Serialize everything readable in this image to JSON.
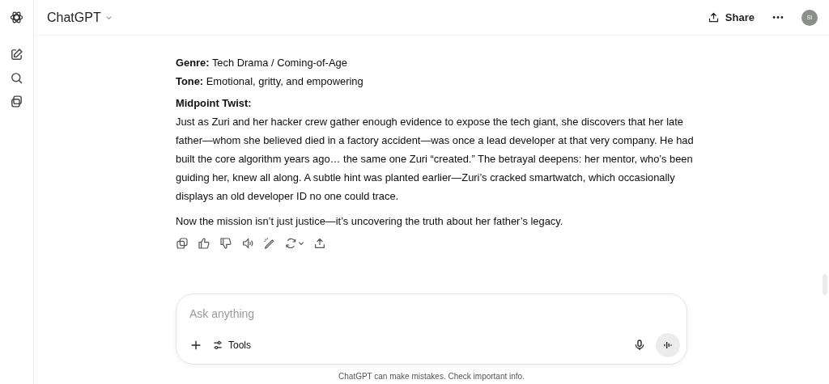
{
  "header": {
    "title": "ChatGPT",
    "share": "Share",
    "avatar": "SI"
  },
  "message": {
    "fields": [
      {
        "label": "Genre:",
        "value": "Tech Drama / Coming-of-Age"
      },
      {
        "label": "Tone:",
        "value": "Emotional, gritty, and empowering"
      }
    ],
    "heading": "Midpoint Twist:",
    "paragraphs": [
      "Just as Zuri and her hacker crew gather enough evidence to expose the tech giant, she discovers that her late father—whom she believed died in a factory accident—was once a lead developer at that very company. He had built the core algorithm years ago… the same one Zuri “created.” The betrayal deepens: her mentor, who’s been guiding her, knew all along. A subtle hint was planted earlier—Zuri’s cracked smartwatch, which occasionally displays an old developer ID no one could trace.",
      "Now the mission isn’t just justice—it’s uncovering the truth about her father’s legacy."
    ]
  },
  "composer": {
    "placeholder": "Ask anything",
    "tools": "Tools"
  },
  "disclaimer": "ChatGPT can make mistakes. Check important info."
}
